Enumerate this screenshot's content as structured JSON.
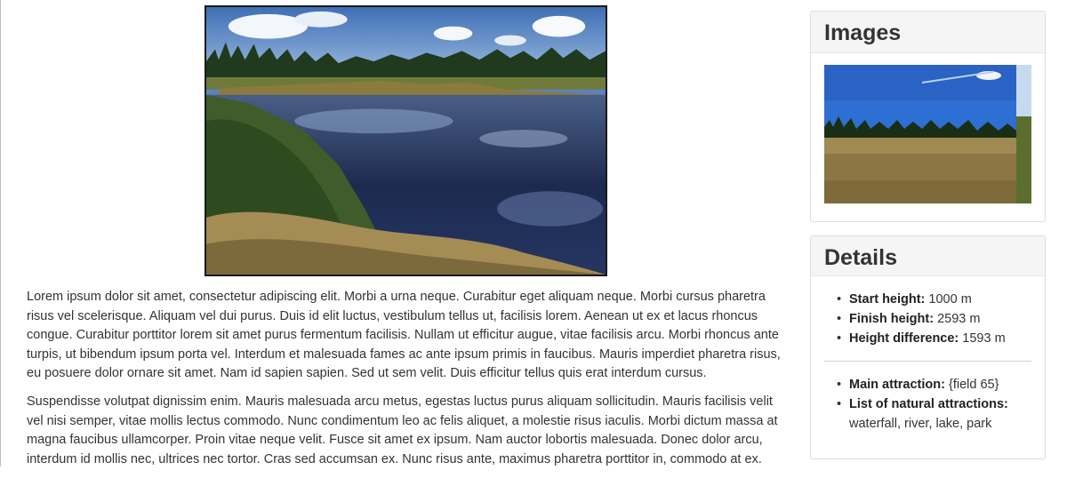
{
  "hero_image": {
    "alt": "Mountain lake with pine trees and grassy shore"
  },
  "paragraphs": [
    "Lorem ipsum dolor sit amet, consectetur adipiscing elit. Morbi a urna neque. Curabitur eget aliquam neque. Morbi cursus pharetra risus vel scelerisque. Aliquam vel dui purus. Duis id elit luctus, vestibulum tellus ut, facilisis lorem. Aenean ut ex et lacus rhoncus congue. Curabitur porttitor lorem sit amet purus fermentum facilisis. Nullam ut efficitur augue, vitae facilisis arcu. Morbi rhoncus ante turpis, ut bibendum ipsum porta vel. Interdum et malesuada fames ac ante ipsum primis in faucibus. Mauris imperdiet pharetra risus, eu posuere dolor ornare sit amet. Nam id sapien sapien. Sed ut sem velit. Duis efficitur tellus quis erat interdum cursus.",
    "Suspendisse volutpat dignissim enim. Mauris malesuada arcu metus, egestas luctus purus aliquam sollicitudin. Mauris facilisis velit vel nisi semper, vitae mollis lectus commodo. Nunc condimentum leo ac felis aliquet, a molestie risus iaculis. Morbi dictum massa at magna faucibus ullamcorper. Proin vitae neque velit. Fusce sit amet ex ipsum. Nam auctor lobortis malesuada. Donec dolor arcu, interdum id mollis nec, ultrices nec tortor. Cras sed accumsan ex. Nunc risus ante, maximus pharetra porttitor in, commodo at ex."
  ],
  "images_panel": {
    "title": "Images",
    "thumb_alt": "Alpine meadow with forest under blue sky"
  },
  "details_panel": {
    "title": "Details",
    "heights": [
      {
        "label": "Start height:",
        "value": "1000 m"
      },
      {
        "label": "Finish height:",
        "value": "2593 m"
      },
      {
        "label": "Height difference:",
        "value": "1593 m"
      }
    ],
    "attractions": [
      {
        "label": "Main attraction:",
        "value": "{field 65}"
      },
      {
        "label": "List of natural attractions:",
        "value": "waterfall, river, lake, park"
      }
    ]
  }
}
